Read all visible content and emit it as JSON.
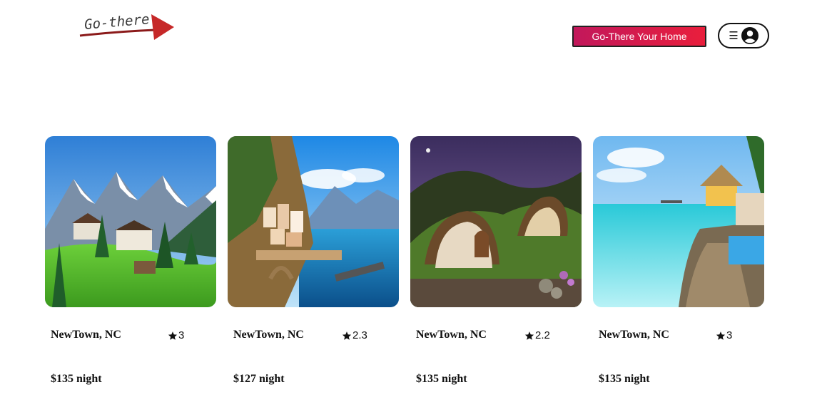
{
  "header": {
    "logo_text": "Go-there",
    "host_button_label": "Go-There Your Home",
    "menu_icon": "hamburger-icon",
    "user_icon": "user-avatar-icon"
  },
  "colors": {
    "accent_start": "#c2185b",
    "accent_end": "#e91e3c",
    "logo_arrow": "#c62828"
  },
  "listings": [
    {
      "location": "NewTown, NC",
      "rating": "3",
      "price": "$135 night",
      "image": "alpine-mountain-village"
    },
    {
      "location": "NewTown, NC",
      "rating": "2.3",
      "price": "$127 night",
      "image": "coastal-cliff-town"
    },
    {
      "location": "NewTown, NC",
      "rating": "2.2",
      "price": "$135 night",
      "image": "hobbit-hill-house"
    },
    {
      "location": "NewTown, NC",
      "rating": "3",
      "price": "$135 night",
      "image": "tropical-beach-hut"
    }
  ]
}
